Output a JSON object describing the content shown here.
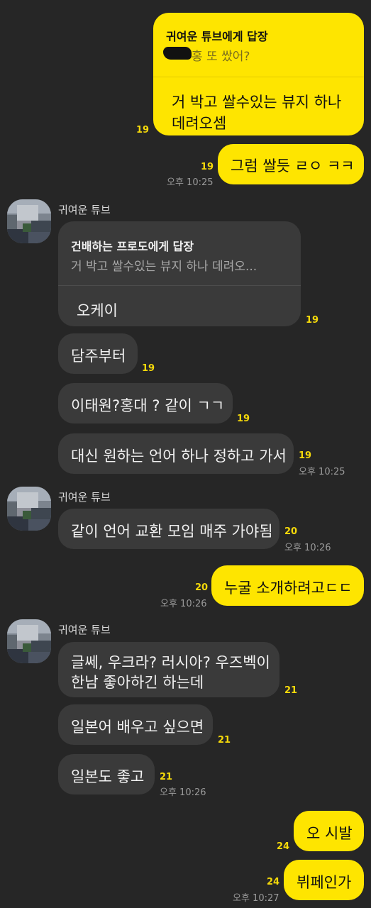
{
  "colors": {
    "background": "#262626",
    "my_bubble": "#fee500",
    "their_bubble": "#3a3a3a",
    "unread_count": "#f5d90a",
    "timestamp": "#9a9a9a"
  },
  "messages": {
    "m1": {
      "reply_header": "귀여운 튜브에게 답장",
      "reply_preview": "홍 또 쌌어?",
      "text_line1": "거 박고 쌀수있는 뷰지 하나",
      "text_line2": "데려오셈",
      "unread": "19"
    },
    "m2": {
      "text": "그럼 쌀듯 ㄹㅇ ㅋㅋ",
      "unread": "19",
      "time": "오후 10:25"
    },
    "sender1": {
      "name": "귀여운 튜브"
    },
    "m3": {
      "reply_header": "건배하는 프로도에게 답장",
      "reply_preview": "거 박고 쌀수있는 뷰지 하나 데려오...",
      "text": "오케이",
      "unread": "19"
    },
    "m4": {
      "text": "담주부터",
      "unread": "19"
    },
    "m5": {
      "text": "이태원?홍대 ? 같이 ㄱㄱ",
      "unread": "19"
    },
    "m6": {
      "text": "대신 원하는 언어 하나 정하고 가서",
      "unread": "19",
      "time": "오후 10:25"
    },
    "sender2": {
      "name": "귀여운 튜브"
    },
    "m7": {
      "text": "같이 언어 교환 모임 매주 가야됨",
      "unread": "20",
      "time": "오후 10:26"
    },
    "m8": {
      "text": "누굴 소개하려고ㄷㄷ",
      "unread": "20",
      "time": "오후 10:26"
    },
    "sender3": {
      "name": "귀여운 튜브"
    },
    "m9": {
      "text_line1": "글쎄, 우크라? 러시아? 우즈벡이",
      "text_line2": "한남 좋아하긴 하는데",
      "unread": "21"
    },
    "m10": {
      "text": "일본어 배우고 싶으면",
      "unread": "21"
    },
    "m11": {
      "text": "일본도 좋고",
      "unread": "21",
      "time": "오후 10:26"
    },
    "m12": {
      "text": "오 시발",
      "unread": "24"
    },
    "m13": {
      "text": "뷔페인가",
      "unread": "24",
      "time": "오후 10:27"
    }
  }
}
